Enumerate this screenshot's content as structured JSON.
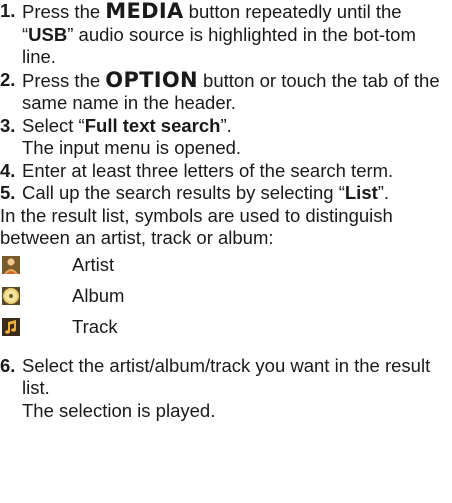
{
  "steps": [
    {
      "num": "1.",
      "pre": "Press the ",
      "button": "MEDIA",
      "mid": " button repeatedly until the “",
      "bold": "USB",
      "post": "” audio source is highlighted in the bot-tom line."
    },
    {
      "num": "2.",
      "pre": "Press the ",
      "button": "OPTION",
      "post": " button or touch the tab of the same name in the header."
    },
    {
      "num": "3.",
      "pre": "Select “",
      "bold": "Full text search",
      "post": "”.",
      "note": "The input menu is opened."
    },
    {
      "num": "4.",
      "text": "Enter at least three letters of the search term."
    },
    {
      "num": "5.",
      "pre": "Call up the search results by selecting “",
      "bold": "List",
      "post": "”."
    }
  ],
  "intro": "In the result list, symbols are used to distinguish between an artist, track or album:",
  "legend": [
    {
      "icon": "artist-icon",
      "label": "Artist"
    },
    {
      "icon": "album-icon",
      "label": "Album"
    },
    {
      "icon": "track-icon",
      "label": "Track"
    }
  ],
  "step6": {
    "num": "6.",
    "text": "Select the artist/album/track you want in the result list.",
    "note": "The selection is played."
  }
}
